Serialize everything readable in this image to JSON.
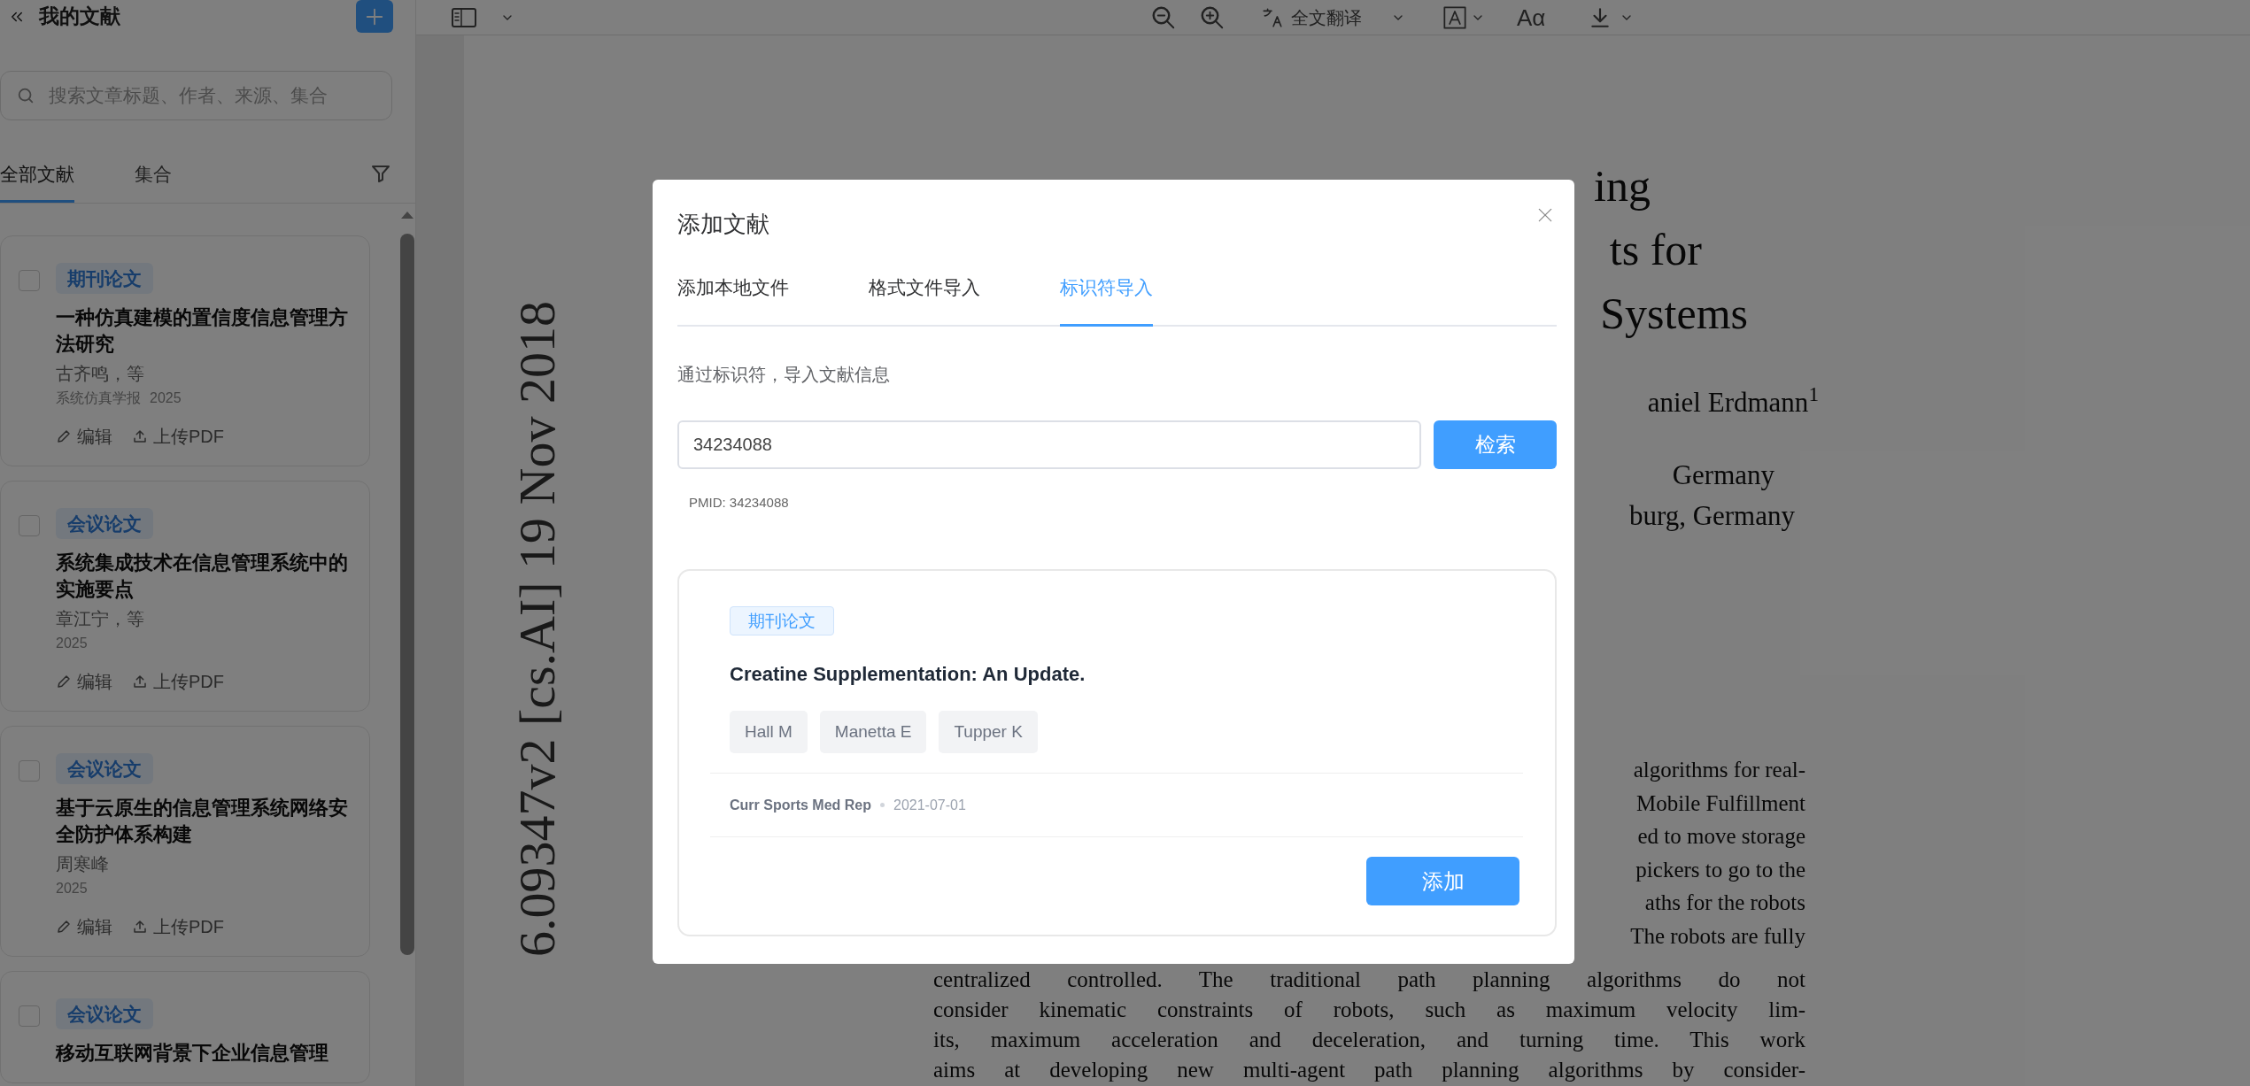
{
  "sidebar": {
    "title": "我的文献",
    "search": {
      "placeholder": "搜索文章标题、作者、来源、集合"
    },
    "tabs": [
      {
        "label": "全部文献",
        "selected": true
      },
      {
        "label": "集合",
        "selected": false
      }
    ],
    "papers": [
      {
        "type": "期刊论文",
        "title": "一种仿真建模的置信度信息管理方法研究",
        "authors": "古齐鸣，等",
        "source": "系统仿真学报",
        "year": "2025",
        "edit": "编辑",
        "upload": "上传PDF",
        "checked": false
      },
      {
        "type": "会议论文",
        "title": "系统集成技术在信息管理系统中的实施要点",
        "authors": "章江宁，等",
        "year": "2025",
        "edit": "编辑",
        "upload": "上传PDF",
        "checked": false
      },
      {
        "type": "会议论文",
        "title": "基于云原生的信息管理系统网络安全防护体系构建",
        "authors": "周寒峰",
        "year": "2025",
        "edit": "编辑",
        "upload": "上传PDF",
        "checked": false
      },
      {
        "type": "会议论文",
        "title": "移动互联网背景下企业信息管理",
        "checked": false
      }
    ]
  },
  "toolbar": {
    "translate": "全文翻译",
    "font_size": "Aα"
  },
  "pdf": {
    "side_stamp": "6.09347v2 [cs.AI] 19 Nov 2018",
    "title_lines": [
      "ing",
      "ts for",
      "Systems"
    ],
    "author_line": "aniel Erdmann$^{1}$",
    "affiliations": [
      "Germany",
      "burg, Germany"
    ],
    "right_lines": [
      "algorithms for real-",
      "Mobile Fulfillment",
      "ed to move storage",
      "pickers to go to the",
      "aths for the robots",
      "The robots are fully"
    ],
    "body_lines": [
      "centralized controlled. The traditional path planning algorithms do not",
      "consider kinematic constraints of robots, such as maximum velocity lim-",
      "its, maximum acceleration and deceleration, and turning time. This work",
      "aims at developing new multi-agent path planning algorithms by consider-"
    ]
  },
  "dialog": {
    "title": "添加文献",
    "tabs": [
      {
        "label": "添加本地文件",
        "selected": false
      },
      {
        "label": "格式文件导入",
        "selected": false
      },
      {
        "label": "标识符导入",
        "selected": true
      }
    ],
    "description": "通过标识符，导入文献信息",
    "identifier": {
      "value": "34234088"
    },
    "search_button": "检索",
    "parsed_hint": "PMID: 34234088",
    "result": {
      "type": "期刊论文",
      "title": "Creatine Supplementation: An Update.",
      "authors": [
        "Hall M",
        "Manetta E",
        "Tupper K"
      ],
      "journal": "Curr Sports Med Rep",
      "date": "2021-07-01",
      "add_button": "添加"
    }
  }
}
